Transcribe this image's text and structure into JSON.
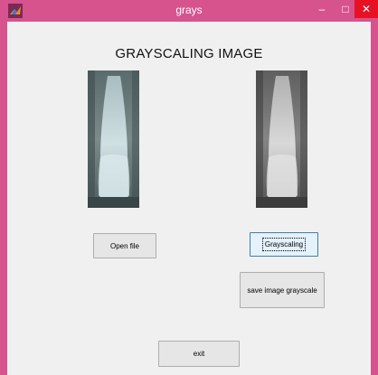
{
  "window": {
    "title": "grays"
  },
  "titlebar": {
    "minimize_glyph": "–",
    "maximize_glyph": "□",
    "close_glyph": "✕",
    "app_icon": "matlab-logo-icon"
  },
  "main": {
    "heading": "GRAYSCALING IMAGE"
  },
  "buttons": {
    "open_file": "Open file",
    "grayscaling": "Grayscaling",
    "save_image": "save image grayscale",
    "exit": "exit"
  },
  "colors": {
    "titlebar": "#d6538e",
    "close_button": "#e81123",
    "client_bg": "#f0f0f0"
  }
}
